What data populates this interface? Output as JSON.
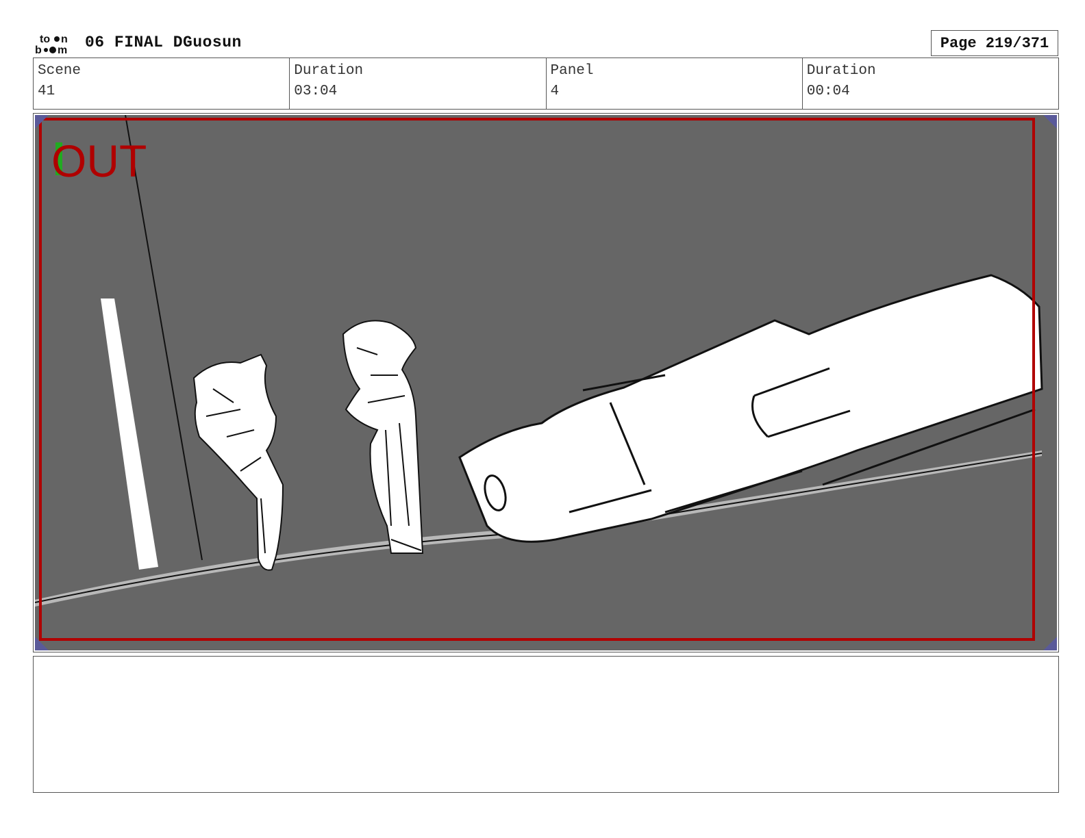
{
  "header": {
    "logo_icon": "toonboom-logo-icon",
    "title": "06 FINAL DGuosun",
    "page": "Page 219/371"
  },
  "info": {
    "scene_label": "Scene",
    "scene_value": "41",
    "duration_label": "Duration",
    "duration_value": "03:04",
    "panel_label": "Panel",
    "panel_value": "4",
    "panel_duration_label": "Duration",
    "panel_duration_value": "00:04"
  },
  "panel": {
    "overlay_text": "OUT",
    "background_color": "#666666",
    "safe_frame_color": "#b00000",
    "overlay_accent_color": "#22aa22"
  },
  "notes": {
    "text": ""
  }
}
